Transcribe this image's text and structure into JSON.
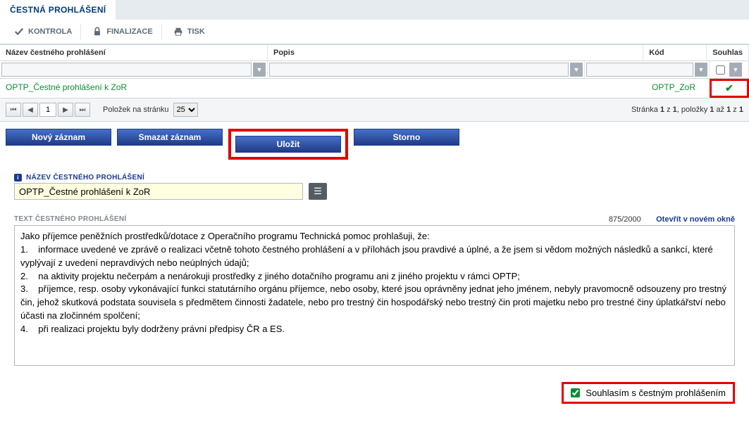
{
  "tab": {
    "title": "ČESTNÁ PROHLÁŠENÍ"
  },
  "toolbar": {
    "kontrola": "KONTROLA",
    "finalizace": "FINALIZACE",
    "tisk": "TISK"
  },
  "grid": {
    "headers": {
      "name": "Název čestného prohlášení",
      "desc": "Popis",
      "code": "Kód",
      "consent": "Souhlas"
    },
    "row": {
      "name": "OPTP_Čestné prohlášení k ZoR",
      "desc": "",
      "code": "OPTP_ZoR"
    }
  },
  "pager": {
    "page": "1",
    "label": "Položek na stránku",
    "size": "25",
    "info_prefix": "Stránka ",
    "info_p1": "1",
    "info_of": " z ",
    "info_pt": "1",
    "info_items": ", položky ",
    "info_i1": "1",
    "info_to": " až ",
    "info_i2": "1",
    "info_of2": " z ",
    "info_it": "1"
  },
  "buttons": {
    "novy": "Nový záznam",
    "smazat": "Smazat záznam",
    "ulozit": "Uložit",
    "storno": "Storno"
  },
  "form": {
    "name_label": "NÁZEV ČESTNÉHO PROHLÁŠENÍ",
    "name_value": "OPTP_Čestné prohlášení k ZoR",
    "text_label": "TEXT ČESTNÉHO PROHLÁŠENÍ",
    "counter": "875/2000",
    "new_window": "Otevřít v novém okně",
    "text_value": "Jako příjemce peněžních prostředků/dotace z Operačního programu Technická pomoc prohlašuji, že:\n1.    informace uvedené ve zprávě o realizaci včetně tohoto čestného prohlášení a v přílohách jsou pravdivé a úplné, a že jsem si vědom možných následků a sankcí, které vyplývají z uvedení nepravdivých nebo neúplných údajů;\n2.    na aktivity projektu nečerpám a nenárokuji prostředky z jiného dotačního programu ani z jiného projektu v rámci OPTP;\n3.    příjemce, resp. osoby vykonávající funkci statutárního orgánu příjemce, nebo osoby, které jsou oprávněny jednat jeho jménem, nebyly pravomocně odsouzeny pro trestný čin, jehož skutková podstata souvisela s předmětem činnosti žadatele, nebo pro trestný čin hospodářský nebo trestný čin proti majetku nebo pro trestné činy úplatkářství nebo účasti na zločinném spolčení;\n4.    při realizaci projektu byly dodrženy právní předpisy ČR a ES.",
    "consent_label": "Souhlasím s čestným prohlášením"
  }
}
